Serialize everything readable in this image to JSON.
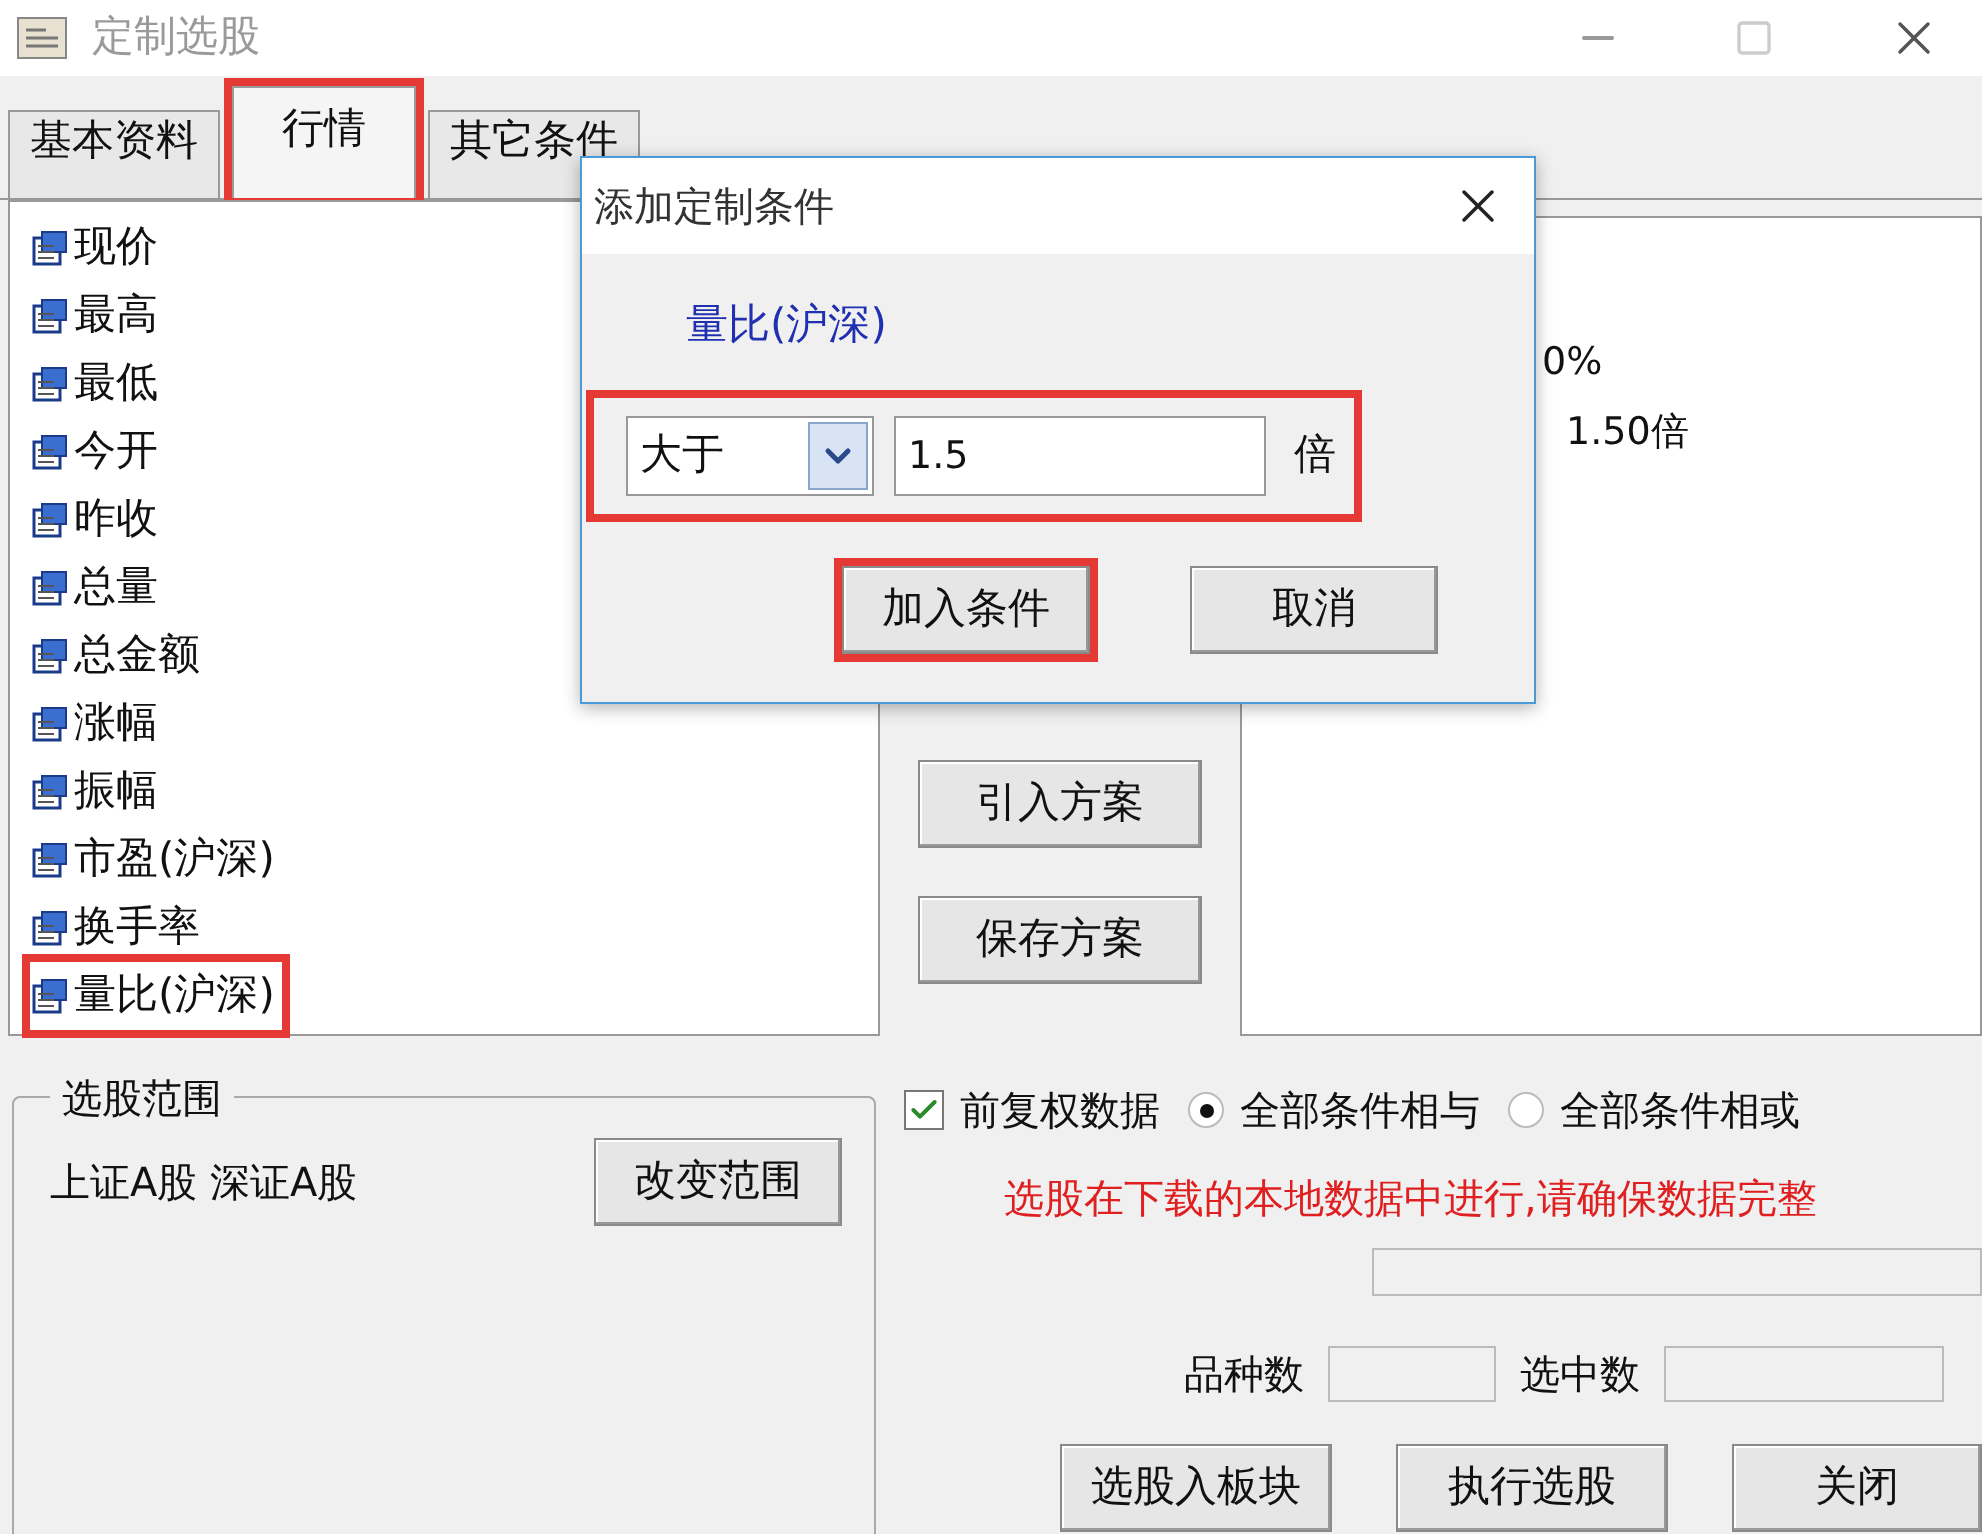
{
  "window": {
    "title": "定制选股"
  },
  "tabs": [
    {
      "label": "基本资料",
      "selected": false,
      "highlighted": false
    },
    {
      "label": "行情",
      "selected": true,
      "highlighted": true
    },
    {
      "label": "其它条件",
      "selected": false,
      "highlighted": false
    }
  ],
  "indicators": [
    {
      "label": "现价",
      "highlighted": false
    },
    {
      "label": "最高",
      "highlighted": false
    },
    {
      "label": "最低",
      "highlighted": false
    },
    {
      "label": "今开",
      "highlighted": false
    },
    {
      "label": "昨收",
      "highlighted": false
    },
    {
      "label": "总量",
      "highlighted": false
    },
    {
      "label": "总金额",
      "highlighted": false
    },
    {
      "label": "涨幅",
      "highlighted": false
    },
    {
      "label": "振幅",
      "highlighted": false
    },
    {
      "label": "市盈(沪深)",
      "highlighted": false
    },
    {
      "label": "换手率",
      "highlighted": false
    },
    {
      "label": "量比(沪深)",
      "highlighted": true
    }
  ],
  "scheme_buttons": [
    "引入方案",
    "保存方案"
  ],
  "conditions_panel": {
    "lines": [
      "0%",
      "1.50倍"
    ]
  },
  "range_group": {
    "title": "选股范围",
    "markets": "上证A股 深证A股",
    "button": "改变范围"
  },
  "options": {
    "checkbox": {
      "label": "前复权数据",
      "checked": true
    },
    "radios": [
      {
        "label": "全部条件相与",
        "selected": true
      },
      {
        "label": "全部条件相或",
        "selected": false
      }
    ],
    "notice": "选股在下载的本地数据中进行,请确保数据完整"
  },
  "counts": [
    {
      "label": "品种数"
    },
    {
      "label": "选中数"
    }
  ],
  "footer_buttons": [
    "选股入板块",
    "执行选股",
    "关闭"
  ],
  "dialog": {
    "title": "添加定制条件",
    "indicator": "量比(沪深)",
    "operator": "大于",
    "value": "1.5",
    "unit": "倍",
    "row_highlighted": true,
    "buttons": [
      {
        "label": "加入条件",
        "highlighted": true
      },
      {
        "label": "取消",
        "highlighted": false
      }
    ]
  }
}
